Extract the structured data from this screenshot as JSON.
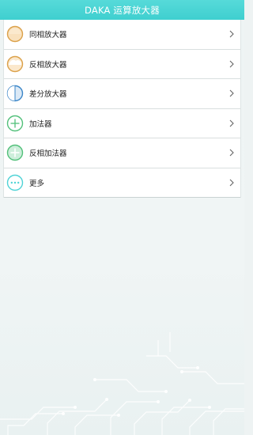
{
  "header": {
    "title": "DAKA 运算放大器"
  },
  "menu": {
    "items": [
      {
        "label": "同相放大器",
        "icon": "noninverting-amplifier-icon"
      },
      {
        "label": "反相放大器",
        "icon": "inverting-amplifier-icon"
      },
      {
        "label": "差分放大器",
        "icon": "differential-amplifier-icon"
      },
      {
        "label": "加法器",
        "icon": "adder-icon"
      },
      {
        "label": "反相加法器",
        "icon": "inverting-adder-icon"
      },
      {
        "label": "更多",
        "icon": "more-icon"
      }
    ]
  },
  "colors": {
    "title_bar": "#45d2d2",
    "orange": "#e0a64a",
    "blue": "#3b86c8",
    "green": "#52c07a",
    "cyan": "#4fd3d6"
  }
}
